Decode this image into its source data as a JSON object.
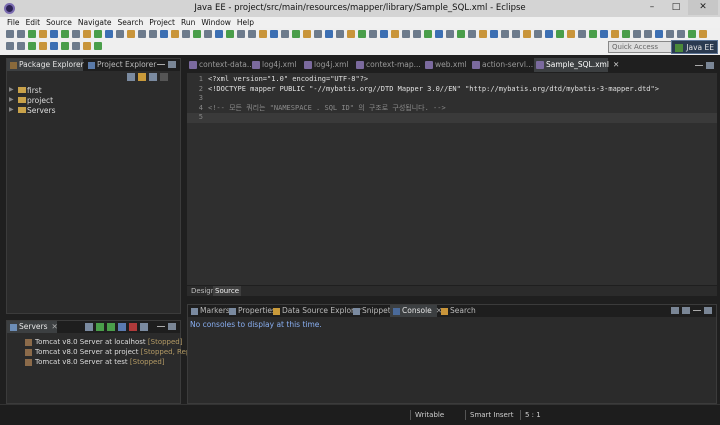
{
  "window": {
    "title": "Java EE - project/src/main/resources/mapper/library/Sample_SQL.xml - Eclipse"
  },
  "menu": [
    "File",
    "Edit",
    "Source",
    "Navigate",
    "Search",
    "Project",
    "Run",
    "Window",
    "Help"
  ],
  "toolbar": {
    "quick_access_placeholder": "Quick Access",
    "perspective": "Java EE"
  },
  "left_top_panel": {
    "tabs": [
      {
        "label": "Package Explorer",
        "icon": "package-explorer-icon",
        "active": true
      },
      {
        "label": "Project Explorer",
        "icon": "project-explorer-icon",
        "active": false
      }
    ],
    "tree": [
      "first",
      "project",
      "Servers"
    ]
  },
  "editor": {
    "tabs": [
      {
        "label": "context-data...",
        "active": false
      },
      {
        "label": "log4j.xml",
        "active": false
      },
      {
        "label": "log4j.xml",
        "active": false
      },
      {
        "label": "context-map...",
        "active": false
      },
      {
        "label": "web.xml",
        "active": false
      },
      {
        "label": "action-servl...",
        "active": false
      },
      {
        "label": "Sample_SQL.xml",
        "active": true
      }
    ],
    "lines": [
      {
        "num": "1",
        "text": "<?xml version=\"1.0\" encoding=\"UTF-8\"?>"
      },
      {
        "num": "2",
        "text": "<!DOCTYPE mapper PUBLIC \"-//mybatis.org//DTD Mapper 3.0//EN\" \"http://mybatis.org/dtd/mybatis-3-mapper.dtd\">"
      },
      {
        "num": "3",
        "text": ""
      },
      {
        "num": "4",
        "text": "<!-- 모든 쿼리는 \"NAMESPACE . SQL ID\" 의 구조로 구성됩니다. -->"
      },
      {
        "num": "5",
        "text": ""
      }
    ],
    "bottom_tabs": [
      "Design",
      "Source"
    ]
  },
  "bottom_panel": {
    "tabs": [
      "Markers",
      "Properties",
      "Data Source Explorer",
      "Snippets",
      "Console",
      "Search"
    ],
    "active_tab": "Console",
    "message": "No consoles to display at this time."
  },
  "servers_panel": {
    "tab": "Servers",
    "servers": [
      {
        "name": "Tomcat v8.0 Server at localhost",
        "state": "[Stopped]"
      },
      {
        "name": "Tomcat v8.0 Server at project",
        "state": "[Stopped, Republi"
      },
      {
        "name": "Tomcat v8.0 Server at test",
        "state": "[Stopped]"
      }
    ]
  },
  "status": {
    "mode": "Writable",
    "insert": "Smart Insert",
    "position": "5 : 1"
  }
}
